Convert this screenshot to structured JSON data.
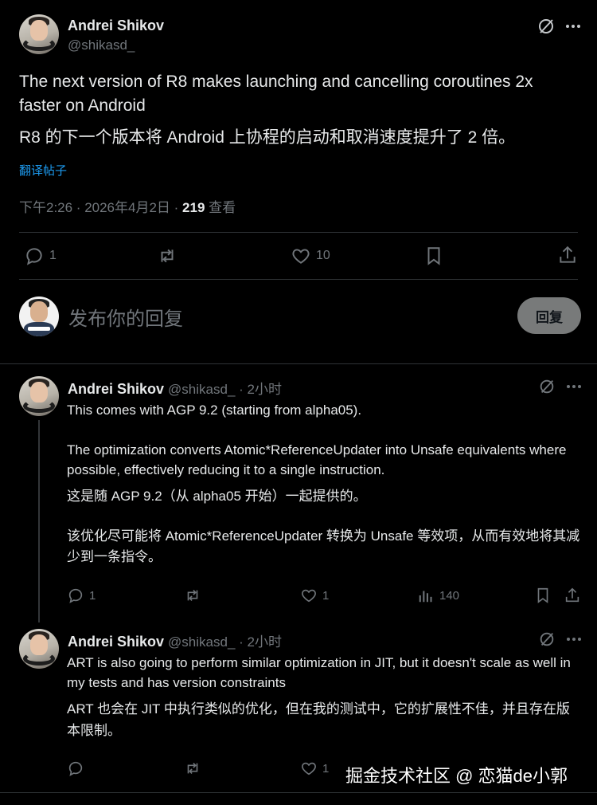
{
  "main_post": {
    "author_name": "Andrei Shikov",
    "handle": "@shikasd_",
    "text_en": "The next version of R8 makes launching and cancelling coroutines 2x faster on Android",
    "text_zh": "R8 的下一个版本将 Android 上协程的启动和取消速度提升了 2 倍。",
    "translate_link": "翻译帖子",
    "time": "下午2:26 · 2026年4月2日 · ",
    "views_count": "219",
    "views_label": " 查看",
    "replies": "1",
    "likes": "10"
  },
  "composer": {
    "placeholder": "发布你的回复",
    "reply_button": "回复"
  },
  "reply1": {
    "author_name": "Andrei Shikov",
    "handle_time": "@shikasd_ · 2小时",
    "en_line1": "This comes with AGP 9.2 (starting from alpha05).",
    "en_para2": "The optimization converts Atomic*ReferenceUpdater into Unsafe equivalents where possible, effectively reducing it to a single instruction.",
    "zh_line1": "这是随 AGP 9.2（从 alpha05 开始）一起提供的。",
    "zh_para2": "该优化尽可能将 Atomic*ReferenceUpdater 转换为 Unsafe 等效项，从而有效地将其减少到一条指令。",
    "replies": "1",
    "likes": "1",
    "views": "140"
  },
  "reply2": {
    "author_name": "Andrei Shikov",
    "handle_time": "@shikasd_ · 2小时",
    "text_en": "ART is also going to perform similar optimization in JIT, but it doesn't scale as well in my tests and has version constraints",
    "text_zh": "ART 也会在 JIT 中执行类似的优化，但在我的测试中，它的扩展性不佳，并且存在版本限制。",
    "likes": "1"
  },
  "watermark": "掘金技术社区 @ 恋猫de小郭",
  "colors": {
    "background": "#000000",
    "text": "#e7e9ea",
    "muted": "#71767b",
    "link": "#1d9bf0",
    "divider": "#2f3336",
    "reply_button_bg": "#787a7a"
  },
  "icons": [
    "grok-icon",
    "more-icon",
    "reply-icon",
    "retweet-icon",
    "like-icon",
    "bookmark-icon",
    "share-icon",
    "views-icon"
  ]
}
